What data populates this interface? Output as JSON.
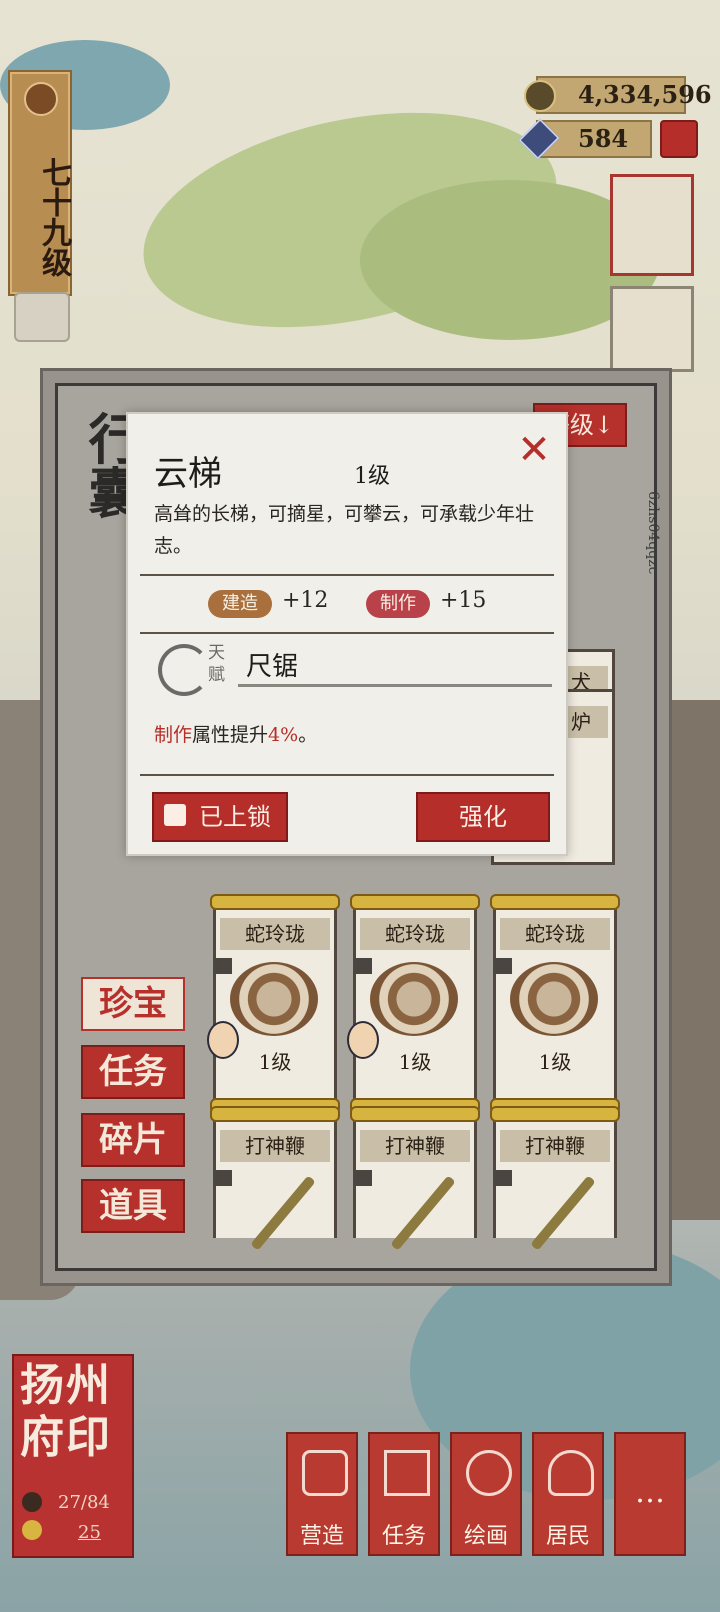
{
  "player": {
    "level": "七十九级"
  },
  "currency": {
    "copper": "4,334,596",
    "gems": "584"
  },
  "panel": {
    "title_partial": "行囊",
    "sort_label": "等级↓",
    "player_id": "6zhs04qqzc",
    "tabs": [
      "珍宝",
      "任务",
      "碎片",
      "道具"
    ],
    "cards_top_partial": [
      "犬",
      "炉"
    ],
    "cards": [
      {
        "name": "蛇玲珑",
        "level": "1级"
      },
      {
        "name": "蛇玲珑",
        "level": "1级"
      },
      {
        "name": "蛇玲珑",
        "level": "1级"
      },
      {
        "name": "打神鞭",
        "level": ""
      },
      {
        "name": "打神鞭",
        "level": ""
      },
      {
        "name": "打神鞭",
        "level": ""
      }
    ]
  },
  "dialog": {
    "item_name": "云梯",
    "item_level": "1级",
    "description": "高耸的长梯，可摘星，可攀云，可承载少年壮志。",
    "stats": [
      {
        "label": "建造",
        "value": "+12"
      },
      {
        "label": "制作",
        "value": "+15"
      }
    ],
    "talent_label": "天赋",
    "talent_name": "尺锯",
    "effect_stat": "制作",
    "effect_text": "属性提升",
    "effect_percent": "4%",
    "effect_end": "。",
    "lock_label": "已上锁",
    "enhance_label": "强化"
  },
  "bottom": {
    "seal_title": "扬州府印",
    "seal_progress": "27/84",
    "seal_count": "25",
    "nav": [
      "营造",
      "任务",
      "绘画",
      "居民",
      "…"
    ]
  },
  "colors": {
    "accent_red": "#b52e2a",
    "gold": "#d7b340",
    "paper": "#f1efe9"
  }
}
